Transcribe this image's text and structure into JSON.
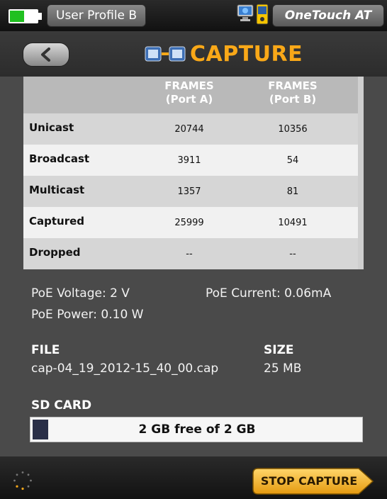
{
  "statusbar": {
    "profile_label": "User Profile B",
    "device_label": "OneTouch AT",
    "battery_icon": "battery-icon",
    "network_icon": "network-icon",
    "tester_icon": "tester-icon"
  },
  "header": {
    "title": "CAPTURE",
    "back_icon": "chevron-left-icon",
    "title_icon": "capture-ports-icon",
    "accent_color": "#f9a818"
  },
  "table": {
    "columns": [
      "FRAMES\n(Port A)",
      "FRAMES\n(Port B)"
    ],
    "col_a_line1": "FRAMES",
    "col_a_line2": "(Port A)",
    "col_b_line1": "FRAMES",
    "col_b_line2": "(Port B)",
    "rows": [
      {
        "label": "Unicast",
        "port_a": "20744",
        "port_b": "10356"
      },
      {
        "label": "Broadcast",
        "port_a": "3911",
        "port_b": "54"
      },
      {
        "label": "Multicast",
        "port_a": "1357",
        "port_b": "81"
      },
      {
        "label": "Captured",
        "port_a": "25999",
        "port_b": "10491"
      },
      {
        "label": "Dropped",
        "port_a": "--",
        "port_b": "--"
      }
    ]
  },
  "poe": {
    "voltage": "PoE Voltage: 2 V",
    "current": "PoE Current: 0.06mA",
    "power": "PoE Power: 0.10 W"
  },
  "file": {
    "file_heading": "FILE",
    "size_heading": "SIZE",
    "file_name": "cap-04_19_2012-15_40_00.cap",
    "file_size": "25 MB"
  },
  "sdcard": {
    "heading": "SD CARD",
    "status": "2 GB free of 2 GB",
    "used_fraction": 0.0
  },
  "footer": {
    "stop_label": "STOP CAPTURE",
    "spinner_icon": "busy-spinner-icon"
  }
}
